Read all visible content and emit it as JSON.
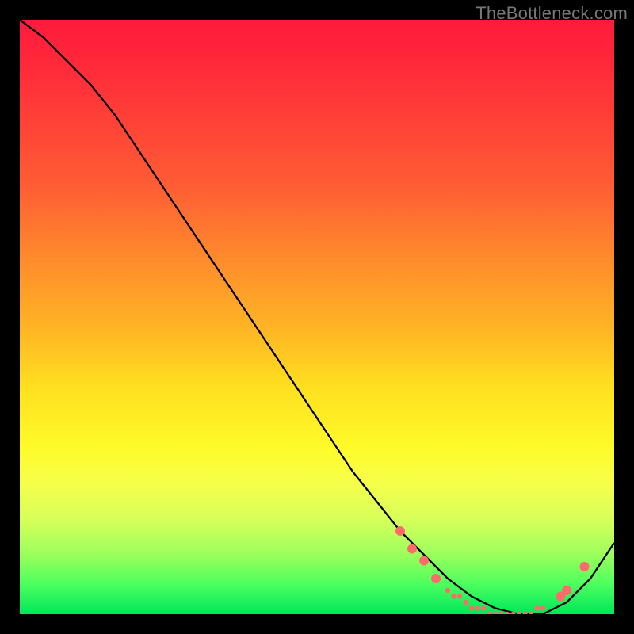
{
  "watermark": "TheBottleneck.com",
  "chart_data": {
    "type": "line",
    "title": "",
    "xlabel": "",
    "ylabel": "",
    "xlim": [
      0,
      100
    ],
    "ylim": [
      0,
      100
    ],
    "grid": false,
    "legend": false,
    "annotations": [],
    "series": [
      {
        "name": "curve",
        "color": "#000000",
        "x": [
          0,
          4,
          8,
          12,
          16,
          20,
          24,
          28,
          32,
          36,
          40,
          44,
          48,
          52,
          56,
          60,
          64,
          68,
          72,
          76,
          80,
          84,
          88,
          92,
          96,
          100
        ],
        "y": [
          100,
          97,
          93,
          89,
          84,
          78,
          72,
          66,
          60,
          54,
          48,
          42,
          36,
          30,
          24,
          19,
          14,
          10,
          6,
          3,
          1,
          0,
          0,
          2,
          6,
          12
        ]
      }
    ],
    "markers": {
      "name": "highlighted-points",
      "color": "#ff6b6b",
      "radius_large": 6,
      "radius_small": 3.2,
      "points": [
        {
          "x": 64,
          "y": 14,
          "r": "large"
        },
        {
          "x": 66,
          "y": 11,
          "r": "large"
        },
        {
          "x": 68,
          "y": 9,
          "r": "large"
        },
        {
          "x": 70,
          "y": 6,
          "r": "large"
        },
        {
          "x": 72,
          "y": 4,
          "r": "small"
        },
        {
          "x": 73,
          "y": 3,
          "r": "small"
        },
        {
          "x": 74,
          "y": 3,
          "r": "small"
        },
        {
          "x": 75,
          "y": 2,
          "r": "small"
        },
        {
          "x": 76,
          "y": 1,
          "r": "small"
        },
        {
          "x": 77,
          "y": 1,
          "r": "small"
        },
        {
          "x": 78,
          "y": 1,
          "r": "small"
        },
        {
          "x": 79,
          "y": 0,
          "r": "small"
        },
        {
          "x": 80,
          "y": 0,
          "r": "small"
        },
        {
          "x": 81,
          "y": 0,
          "r": "small"
        },
        {
          "x": 82,
          "y": 0,
          "r": "small"
        },
        {
          "x": 83,
          "y": 0,
          "r": "small"
        },
        {
          "x": 84,
          "y": 0,
          "r": "small"
        },
        {
          "x": 85,
          "y": 0,
          "r": "small"
        },
        {
          "x": 86,
          "y": 0,
          "r": "small"
        },
        {
          "x": 87,
          "y": 1,
          "r": "small"
        },
        {
          "x": 88,
          "y": 1,
          "r": "small"
        },
        {
          "x": 91,
          "y": 3,
          "r": "large"
        },
        {
          "x": 92,
          "y": 4,
          "r": "large"
        },
        {
          "x": 95,
          "y": 8,
          "r": "large"
        }
      ]
    }
  }
}
